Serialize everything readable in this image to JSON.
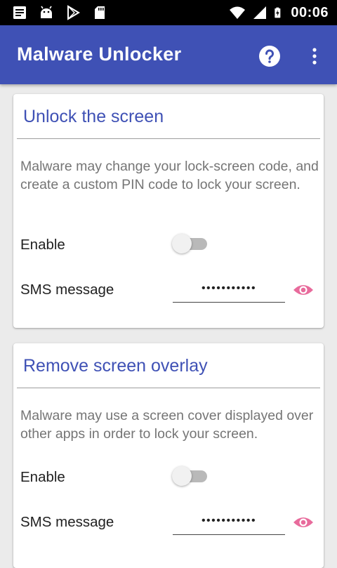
{
  "status_bar": {
    "time": "00:06",
    "icons": [
      "notes-icon",
      "android-icon",
      "play-store-icon",
      "sd-card-icon",
      "wifi-icon",
      "signal-icon",
      "battery-charging-icon"
    ]
  },
  "app_bar": {
    "title": "Malware Unlocker",
    "actions": [
      "help-icon",
      "overflow-menu-icon"
    ]
  },
  "colors": {
    "primary": "#3f51b5",
    "eye_accent": "#e86b9c",
    "description_text": "#757575"
  },
  "cards": [
    {
      "title": "Unlock the screen",
      "description": "Malware may change your lock-screen code, and create a custom PIN code to lock your screen.",
      "enable_label": "Enable",
      "enabled": false,
      "sms_label": "SMS message",
      "sms_value": "•••••••••••"
    },
    {
      "title": "Remove screen overlay",
      "description": "Malware may use a screen cover displayed over other apps in order to lock your screen.",
      "enable_label": "Enable",
      "enabled": false,
      "sms_label": "SMS message",
      "sms_value": "•••••••••••"
    }
  ]
}
